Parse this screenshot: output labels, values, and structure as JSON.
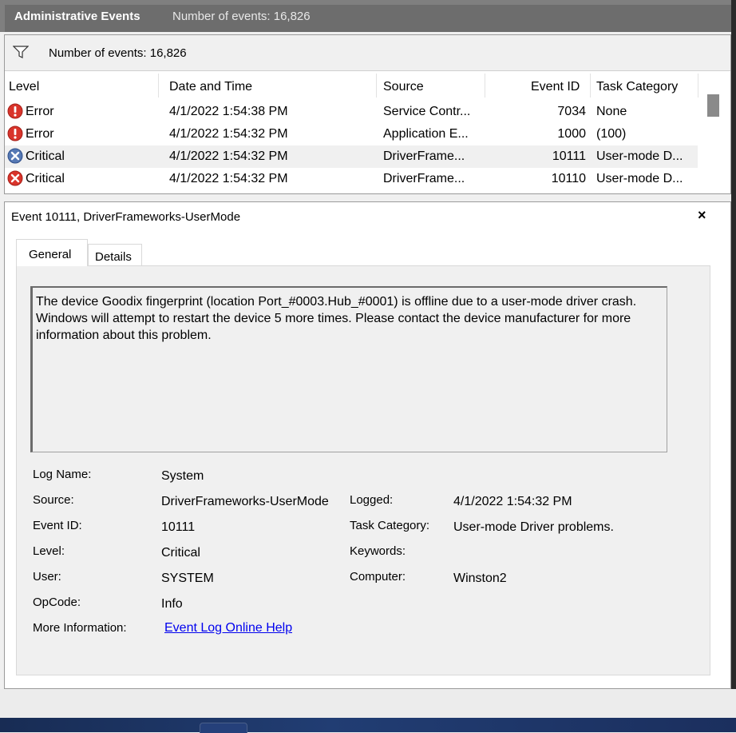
{
  "titlebar": {
    "title": "Administrative Events",
    "count": "Number of events: 16,826"
  },
  "filter": {
    "text": "Number of events: 16,826",
    "icon": "filter-icon"
  },
  "events_grid": {
    "columns": [
      "Level",
      "Date and Time",
      "Source",
      "Event ID",
      "Task Category"
    ],
    "rows": [
      {
        "level": "Error",
        "icon": "error-icon",
        "date": "4/1/2022 1:54:38 PM",
        "source": "Service Contr...",
        "event_id": "7034",
        "category": "None",
        "selected": false
      },
      {
        "level": "Error",
        "icon": "error-icon",
        "date": "4/1/2022 1:54:32 PM",
        "source": "Application E...",
        "event_id": "1000",
        "category": "(100)",
        "selected": false
      },
      {
        "level": "Critical",
        "icon": "critical-icon",
        "date": "4/1/2022 1:54:32 PM",
        "source": "DriverFrame...",
        "event_id": "10111",
        "category": "User-mode D...",
        "selected": true
      },
      {
        "level": "Critical",
        "icon": "critical-icon",
        "date": "4/1/2022 1:54:32 PM",
        "source": "DriverFrame...",
        "event_id": "10110",
        "category": "User-mode D...",
        "selected": false
      }
    ]
  },
  "detail": {
    "header": "Event 10111, DriverFrameworks-UserMode",
    "close_icon": "×",
    "tabs": [
      "General",
      "Details"
    ],
    "message": "The device Goodix fingerprint (location Port_#0003.Hub_#0001) is offline due to a user-mode driver crash.  Windows will attempt to restart the device 5 more times.  Please contact the device manufacturer for more information about this problem.",
    "fields": {
      "log_name_label": "Log Name:",
      "log_name": "System",
      "source_label": "Source:",
      "source": "DriverFrameworks-UserMode",
      "logged_label": "Logged:",
      "logged": "4/1/2022 1:54:32 PM",
      "event_id_label": "Event ID:",
      "event_id": "10111",
      "task_category_label": "Task Category:",
      "task_category": "User-mode Driver problems.",
      "level_label": "Level:",
      "level": "Critical",
      "keywords_label": "Keywords:",
      "keywords": "",
      "user_label": "User:",
      "user": "SYSTEM",
      "computer_label": "Computer:",
      "computer": "Winston2",
      "opcode_label": "OpCode:",
      "opcode": "Info",
      "more_info_label": "More Information:",
      "more_info_link": "Event Log Online Help"
    }
  },
  "colors": {
    "titlebar_bg": "#6d6d6d",
    "selected_row": "#f0f0f0",
    "error_red": "#d9342b",
    "critical_blue": "#5578b4",
    "link": "#0000ee"
  }
}
